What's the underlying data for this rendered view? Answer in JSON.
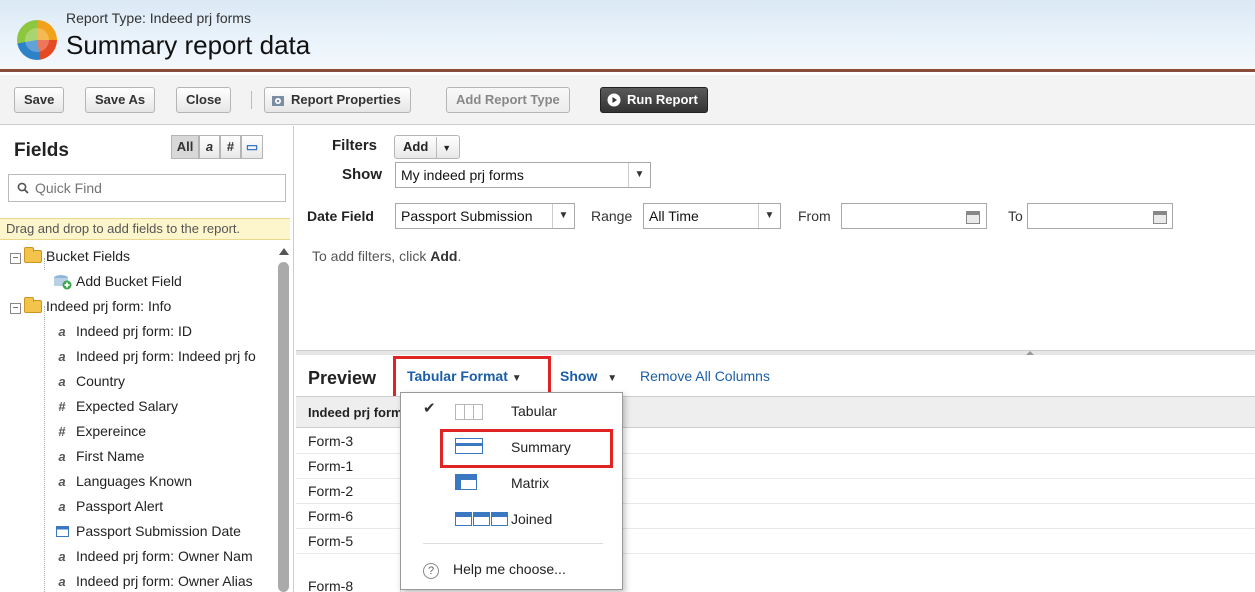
{
  "header": {
    "report_type_label": "Report Type: Indeed prj forms",
    "title": "Summary report data"
  },
  "toolbar": {
    "save": "Save",
    "save_as": "Save As",
    "close": "Close",
    "report_properties": "Report Properties",
    "add_report_type": "Add Report Type",
    "run_report": "Run Report"
  },
  "fields_panel": {
    "title": "Fields",
    "type_filters": [
      "All",
      "a",
      "#",
      "▭"
    ],
    "quick_find_placeholder": "Quick Find",
    "hint": "Drag and drop to add fields to the report.",
    "tree": [
      {
        "label": "Bucket Fields",
        "kind": "folder"
      },
      {
        "label": "Add Bucket Field",
        "kind": "add-bucket"
      },
      {
        "label": "Indeed prj form: Info",
        "kind": "folder"
      },
      {
        "label": "Indeed prj form: ID",
        "kind": "text"
      },
      {
        "label": "Indeed prj form: Indeed prj fo",
        "kind": "text"
      },
      {
        "label": "Country",
        "kind": "text"
      },
      {
        "label": "Expected Salary",
        "kind": "number"
      },
      {
        "label": "Expereince",
        "kind": "number"
      },
      {
        "label": "First Name",
        "kind": "text"
      },
      {
        "label": "Languages Known",
        "kind": "text"
      },
      {
        "label": "Passport Alert",
        "kind": "text"
      },
      {
        "label": "Passport Submission Date",
        "kind": "date"
      },
      {
        "label": "Indeed prj form: Owner Nam",
        "kind": "text"
      },
      {
        "label": "Indeed prj form: Owner Alias",
        "kind": "text"
      }
    ]
  },
  "filters": {
    "filters_label": "Filters",
    "add_label": "Add",
    "show_label": "Show",
    "show_value": "My indeed prj forms",
    "date_field_label": "Date Field",
    "date_field_value": "Passport Submission",
    "range_label": "Range",
    "range_value": "All Time",
    "from_label": "From",
    "to_label": "To",
    "hint_prefix": "To add filters, click ",
    "hint_action": "Add",
    "hint_suffix": "."
  },
  "preview": {
    "title": "Preview",
    "format_button": "Tabular Format",
    "show_label": "Show",
    "remove_all": "Remove All Columns",
    "column_header": "Indeed prj form",
    "rows": [
      "Form-3",
      "Form-1",
      "Form-2",
      "Form-6",
      "Form-5",
      "Form-8"
    ]
  },
  "format_menu": {
    "items": [
      {
        "label": "Tabular",
        "checked": true,
        "icon": "tabular-icon"
      },
      {
        "label": "Summary",
        "checked": false,
        "icon": "summary-icon"
      },
      {
        "label": "Matrix",
        "checked": false,
        "icon": "matrix-icon"
      },
      {
        "label": "Joined",
        "checked": false,
        "icon": "joined-icon"
      }
    ],
    "help": "Help me choose..."
  },
  "colors": {
    "link": "#1a5ea8",
    "highlight": "#e02424",
    "header_border": "#8a4b3a",
    "hint_bg": "#fdf5cb"
  }
}
